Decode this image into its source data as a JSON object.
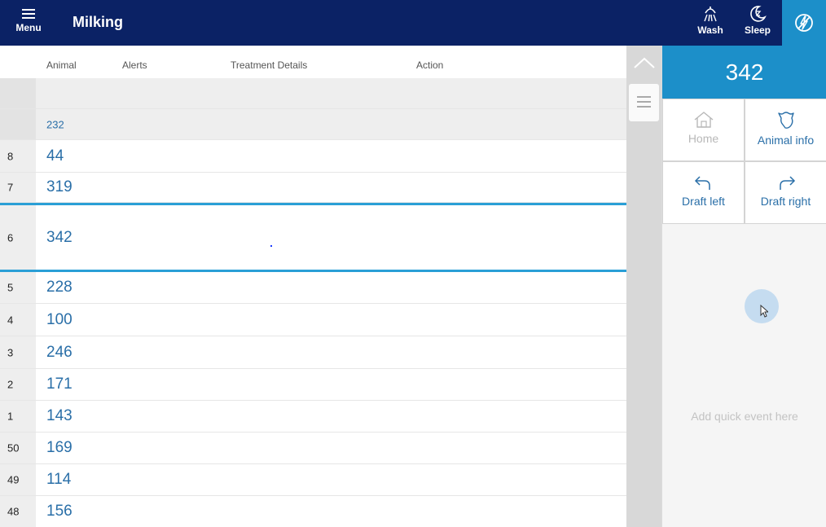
{
  "topbar": {
    "menu_label": "Menu",
    "title": "Milking",
    "wash_label": "Wash",
    "sleep_label": "Sleep",
    "colors": {
      "bar": "#0b2265",
      "accent": "#1c8fc9"
    }
  },
  "table": {
    "headers": {
      "animal": "Animal",
      "alerts": "Alerts",
      "treatment": "Treatment Details",
      "action": "Action"
    },
    "rows": [
      {
        "stall": "",
        "animal": ""
      },
      {
        "stall": "",
        "animal": "232"
      },
      {
        "stall": "8",
        "animal": "44"
      },
      {
        "stall": "7",
        "animal": "319"
      },
      {
        "stall": "6",
        "animal": "342"
      },
      {
        "stall": "5",
        "animal": "228"
      },
      {
        "stall": "4",
        "animal": "100"
      },
      {
        "stall": "3",
        "animal": "246"
      },
      {
        "stall": "2",
        "animal": "171"
      },
      {
        "stall": "1",
        "animal": "143"
      },
      {
        "stall": "50",
        "animal": "169"
      },
      {
        "stall": "49",
        "animal": "114"
      },
      {
        "stall": "48",
        "animal": "156"
      }
    ]
  },
  "panel": {
    "animal_id": "342",
    "home_label": "Home",
    "animal_info_label": "Animal info",
    "draft_left_label": "Draft left",
    "draft_right_label": "Draft right",
    "quick_event_placeholder": "Add quick event here"
  }
}
